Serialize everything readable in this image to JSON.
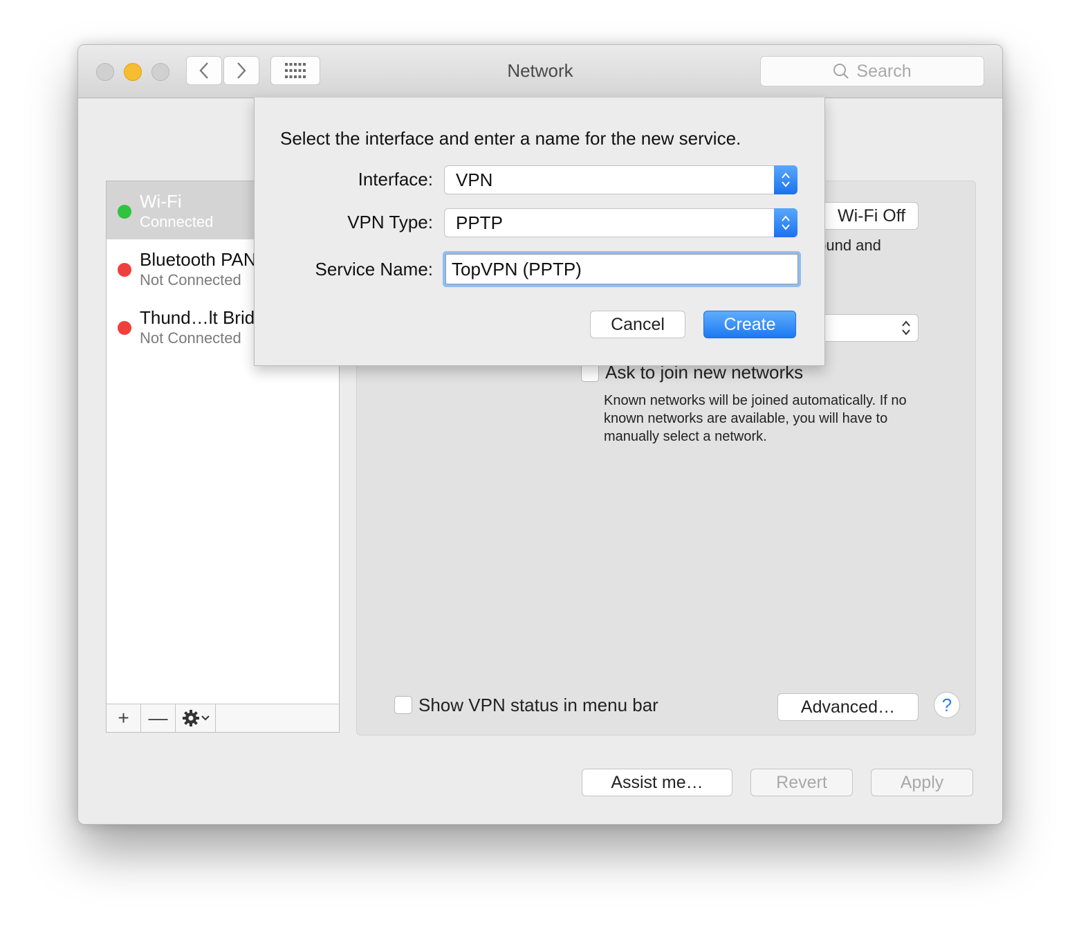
{
  "window": {
    "title": "Network",
    "search_placeholder": "Search"
  },
  "sidebar": {
    "services": [
      {
        "name": "Wi-Fi",
        "status": "Connected",
        "color": "#2fc33f"
      },
      {
        "name": "Bluetooth PAN",
        "status": "Not Connected",
        "color": "#f0403d"
      },
      {
        "name": "Thund…lt Bridge",
        "status": "Not Connected",
        "color": "#f0403d"
      }
    ],
    "add_label": "+",
    "remove_label": "—"
  },
  "panel": {
    "wifi_off_label": "Wi-Fi Off",
    "partial_text_1": "found and",
    "partial_text_2": ".",
    "ask_join_label": "Ask to join new networks",
    "ask_join_description": "Known networks will be joined automatically. If no known networks are available, you will have to manually select a network.",
    "show_vpn_label": "Show VPN status in menu bar",
    "advanced_label": "Advanced…",
    "help_label": "?"
  },
  "footer": {
    "assist_label": "Assist me…",
    "revert_label": "Revert",
    "apply_label": "Apply"
  },
  "sheet": {
    "prompt": "Select the interface and enter a name for the new service.",
    "interface_label": "Interface:",
    "interface_value": "VPN",
    "vpn_type_label": "VPN Type:",
    "vpn_type_value": "PPTP",
    "service_name_label": "Service Name:",
    "service_name_value": "TopVPN (PPTP)",
    "cancel_label": "Cancel",
    "create_label": "Create",
    "accent_color": "#1c79f2"
  }
}
